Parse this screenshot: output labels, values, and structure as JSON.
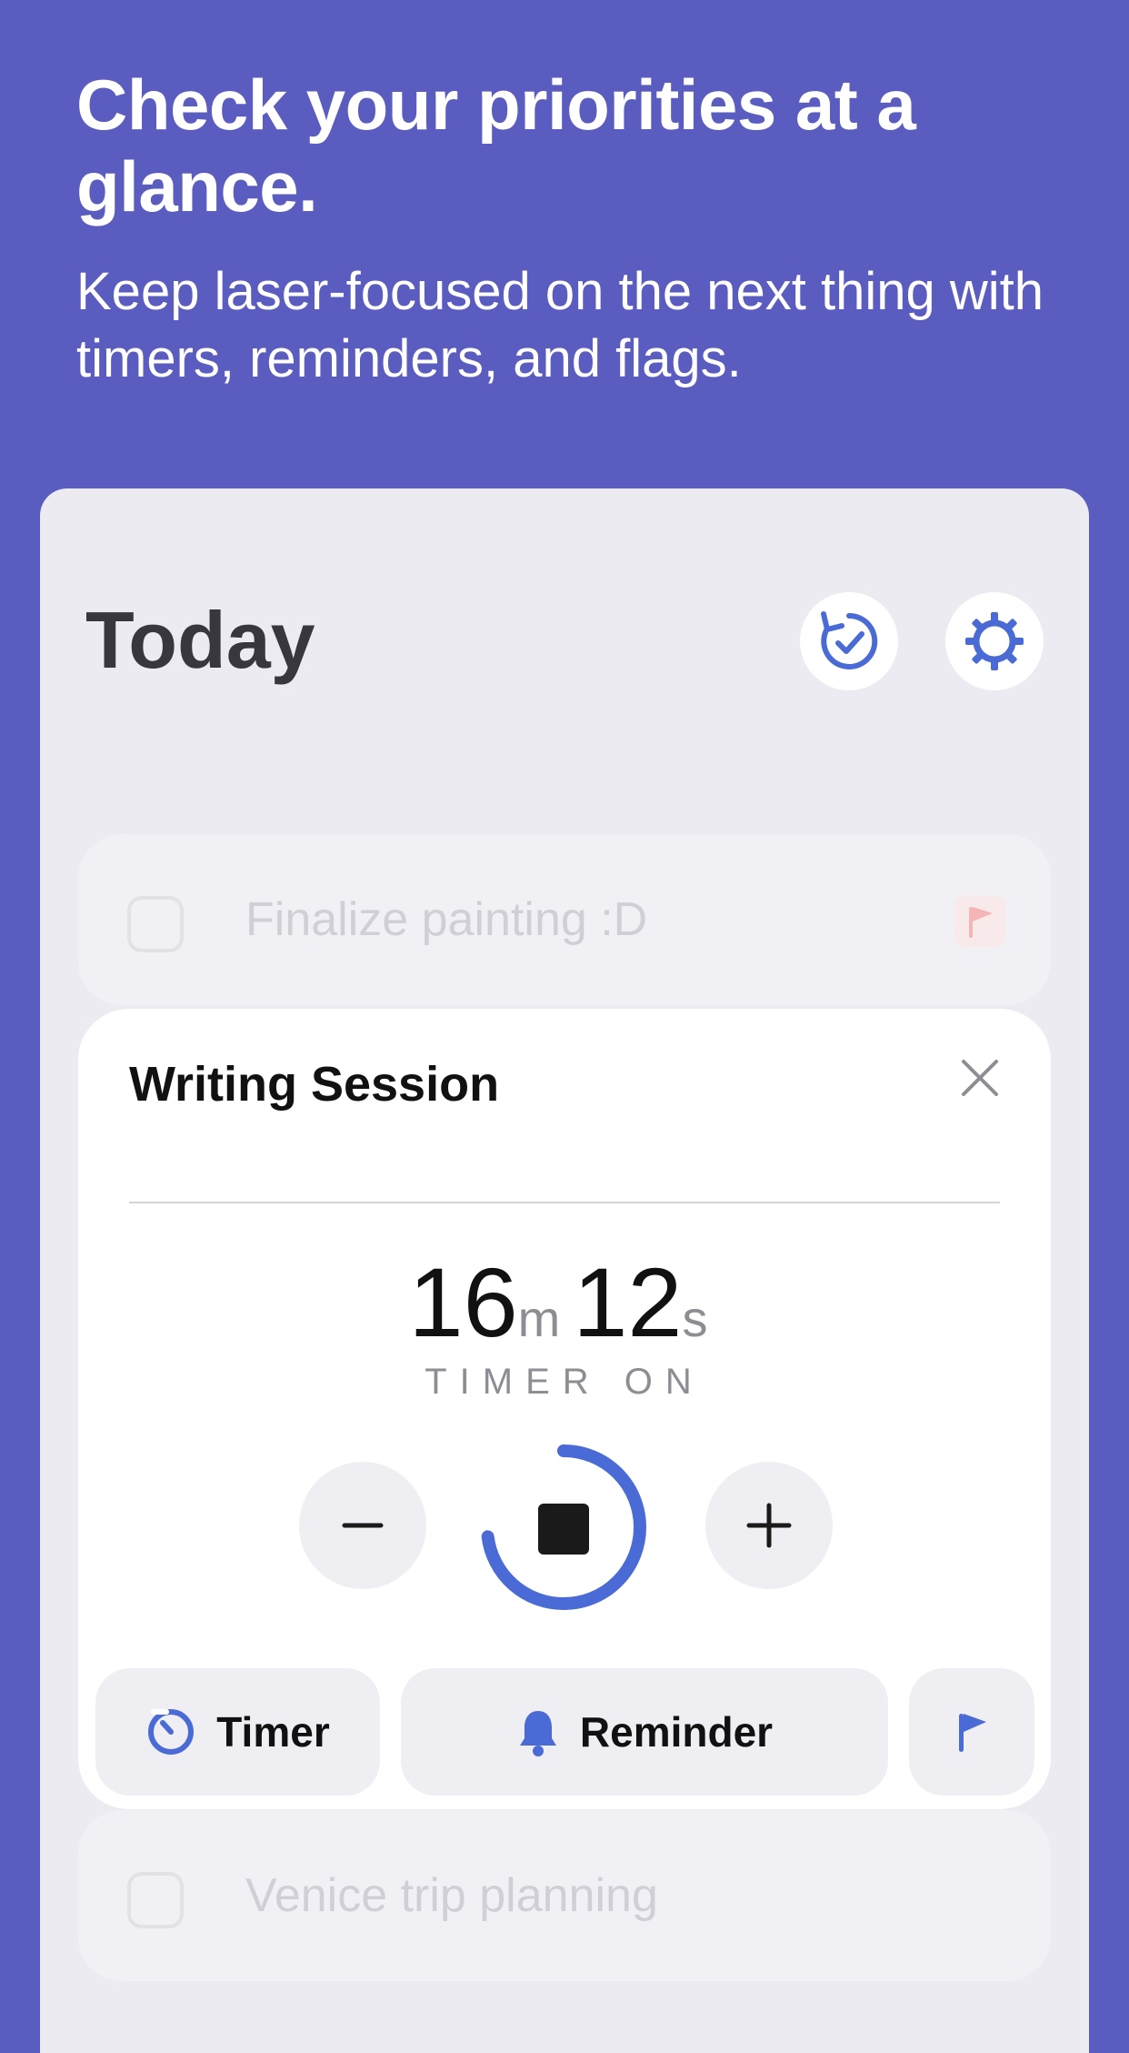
{
  "promo": {
    "title": "Check your priorities at a glance.",
    "subtitle": "Keep laser-focused on the next thing with timers, reminders, and flags."
  },
  "header": {
    "title": "Today",
    "buttons": [
      {
        "icon": "refresh-check-icon"
      },
      {
        "icon": "gear-icon"
      }
    ]
  },
  "tasks": [
    {
      "label": "Finalize painting :D",
      "flagged": true
    },
    {
      "label": "Venice trip planning",
      "flagged": false
    }
  ],
  "active_task": {
    "title": "Writing Session",
    "timer": {
      "minutes": "16",
      "minutes_unit": "m",
      "seconds": "12",
      "seconds_unit": "s",
      "status": "TIMER ON",
      "progress": 0.73
    },
    "actions": {
      "timer_label": "Timer",
      "reminder_label": "Reminder"
    }
  },
  "colors": {
    "background": "#5b5cbf",
    "accent": "#4a6bd6",
    "surface": "#ebebf1",
    "card": "#ffffff"
  }
}
